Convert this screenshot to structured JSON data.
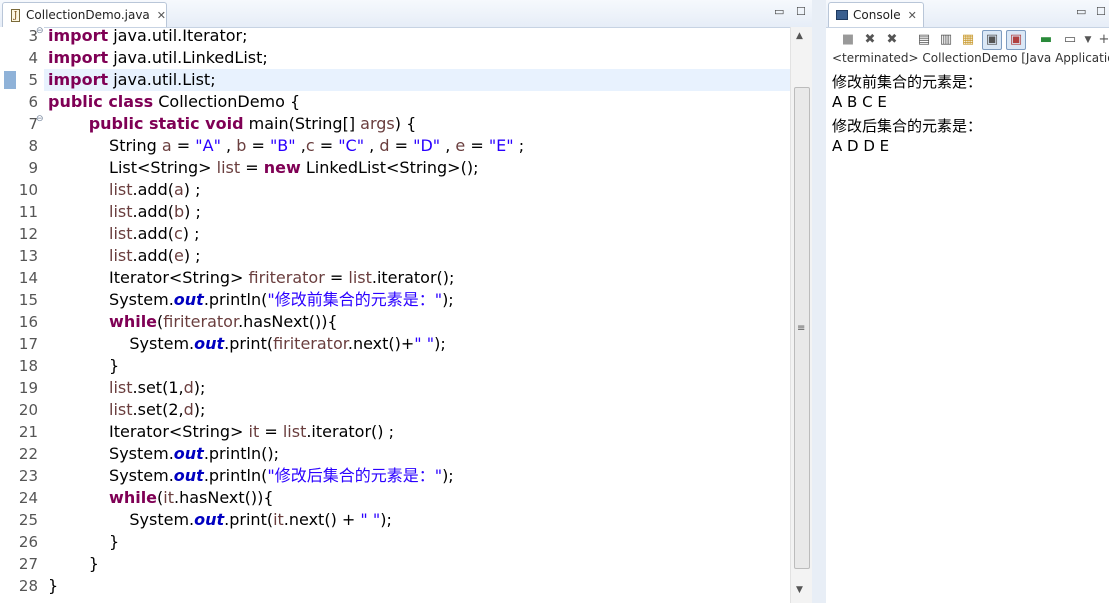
{
  "editor": {
    "tab_title": "CollectionDemo.java",
    "lines": [
      {
        "n": "3",
        "fold": "⊖",
        "tokens": [
          {
            "t": "import",
            "c": "kw"
          },
          {
            "t": " java.util.Iterator;"
          }
        ]
      },
      {
        "n": "4",
        "tokens": [
          {
            "t": "import",
            "c": "kw"
          },
          {
            "t": " java.util.LinkedList;"
          }
        ]
      },
      {
        "n": "5",
        "cur": true,
        "tokens": [
          {
            "t": "import",
            "c": "kw"
          },
          {
            "t": " java.util.List;"
          }
        ]
      },
      {
        "n": "6",
        "tokens": [
          {
            "t": "public class",
            "c": "kw"
          },
          {
            "t": " CollectionDemo {"
          }
        ]
      },
      {
        "n": "7",
        "fold": "⊖",
        "tokens": [
          {
            "t": "        "
          },
          {
            "t": "public static void",
            "c": "kw"
          },
          {
            "t": " main(String[] "
          },
          {
            "t": "args",
            "c": "var"
          },
          {
            "t": ") {"
          }
        ]
      },
      {
        "n": "8",
        "tokens": [
          {
            "t": "            String "
          },
          {
            "t": "a",
            "c": "var"
          },
          {
            "t": " = "
          },
          {
            "t": "\"A\"",
            "c": "str"
          },
          {
            "t": " , "
          },
          {
            "t": "b",
            "c": "var"
          },
          {
            "t": " = "
          },
          {
            "t": "\"B\"",
            "c": "str"
          },
          {
            "t": " ,"
          },
          {
            "t": "c",
            "c": "var"
          },
          {
            "t": " = "
          },
          {
            "t": "\"C\"",
            "c": "str"
          },
          {
            "t": " , "
          },
          {
            "t": "d",
            "c": "var"
          },
          {
            "t": " = "
          },
          {
            "t": "\"D\"",
            "c": "str"
          },
          {
            "t": " , "
          },
          {
            "t": "e",
            "c": "var"
          },
          {
            "t": " = "
          },
          {
            "t": "\"E\"",
            "c": "str"
          },
          {
            "t": " ;"
          }
        ]
      },
      {
        "n": "9",
        "tokens": [
          {
            "t": "            List<String> "
          },
          {
            "t": "list",
            "c": "var"
          },
          {
            "t": " = "
          },
          {
            "t": "new",
            "c": "kw"
          },
          {
            "t": " LinkedList<String>();"
          }
        ]
      },
      {
        "n": "10",
        "tokens": [
          {
            "t": "            "
          },
          {
            "t": "list",
            "c": "var"
          },
          {
            "t": ".add("
          },
          {
            "t": "a",
            "c": "var"
          },
          {
            "t": ") ;"
          }
        ]
      },
      {
        "n": "11",
        "tokens": [
          {
            "t": "            "
          },
          {
            "t": "list",
            "c": "var"
          },
          {
            "t": ".add("
          },
          {
            "t": "b",
            "c": "var"
          },
          {
            "t": ") ;"
          }
        ]
      },
      {
        "n": "12",
        "tokens": [
          {
            "t": "            "
          },
          {
            "t": "list",
            "c": "var"
          },
          {
            "t": ".add("
          },
          {
            "t": "c",
            "c": "var"
          },
          {
            "t": ") ;"
          }
        ]
      },
      {
        "n": "13",
        "tokens": [
          {
            "t": "            "
          },
          {
            "t": "list",
            "c": "var"
          },
          {
            "t": ".add("
          },
          {
            "t": "e",
            "c": "var"
          },
          {
            "t": ") ;"
          }
        ]
      },
      {
        "n": "14",
        "tokens": [
          {
            "t": "            Iterator<String> "
          },
          {
            "t": "firiterator",
            "c": "var"
          },
          {
            "t": " = "
          },
          {
            "t": "list",
            "c": "var"
          },
          {
            "t": ".iterator();"
          }
        ]
      },
      {
        "n": "15",
        "tokens": [
          {
            "t": "            System."
          },
          {
            "t": "out",
            "c": "fld"
          },
          {
            "t": ".println("
          },
          {
            "t": "\"修改前集合的元素是：\"",
            "c": "str"
          },
          {
            "t": ");"
          }
        ]
      },
      {
        "n": "16",
        "tokens": [
          {
            "t": "            "
          },
          {
            "t": "while",
            "c": "kw"
          },
          {
            "t": "("
          },
          {
            "t": "firiterator",
            "c": "var"
          },
          {
            "t": ".hasNext()){"
          }
        ]
      },
      {
        "n": "17",
        "tokens": [
          {
            "t": "                System."
          },
          {
            "t": "out",
            "c": "fld"
          },
          {
            "t": ".print("
          },
          {
            "t": "firiterator",
            "c": "var"
          },
          {
            "t": ".next()+"
          },
          {
            "t": "\" \"",
            "c": "str"
          },
          {
            "t": ");"
          }
        ]
      },
      {
        "n": "18",
        "tokens": [
          {
            "t": "            }"
          }
        ]
      },
      {
        "n": "19",
        "tokens": [
          {
            "t": "            "
          },
          {
            "t": "list",
            "c": "var"
          },
          {
            "t": ".set(1,"
          },
          {
            "t": "d",
            "c": "var"
          },
          {
            "t": ");"
          }
        ]
      },
      {
        "n": "20",
        "tokens": [
          {
            "t": "            "
          },
          {
            "t": "list",
            "c": "var"
          },
          {
            "t": ".set(2,"
          },
          {
            "t": "d",
            "c": "var"
          },
          {
            "t": ");"
          }
        ]
      },
      {
        "n": "21",
        "tokens": [
          {
            "t": "            Iterator<String> "
          },
          {
            "t": "it",
            "c": "var"
          },
          {
            "t": " = "
          },
          {
            "t": "list",
            "c": "var"
          },
          {
            "t": ".iterator() ;"
          }
        ]
      },
      {
        "n": "22",
        "tokens": [
          {
            "t": "            System."
          },
          {
            "t": "out",
            "c": "fld"
          },
          {
            "t": ".println();"
          }
        ]
      },
      {
        "n": "23",
        "tokens": [
          {
            "t": "            System."
          },
          {
            "t": "out",
            "c": "fld"
          },
          {
            "t": ".println("
          },
          {
            "t": "\"修改后集合的元素是：\"",
            "c": "str"
          },
          {
            "t": ");"
          }
        ]
      },
      {
        "n": "24",
        "tokens": [
          {
            "t": "            "
          },
          {
            "t": "while",
            "c": "kw"
          },
          {
            "t": "("
          },
          {
            "t": "it",
            "c": "var"
          },
          {
            "t": ".hasNext()){"
          }
        ]
      },
      {
        "n": "25",
        "tokens": [
          {
            "t": "                System."
          },
          {
            "t": "out",
            "c": "fld"
          },
          {
            "t": ".print("
          },
          {
            "t": "it",
            "c": "var"
          },
          {
            "t": ".next() + "
          },
          {
            "t": "\" \"",
            "c": "str"
          },
          {
            "t": ");"
          }
        ]
      },
      {
        "n": "26",
        "tokens": [
          {
            "t": "            }"
          }
        ]
      },
      {
        "n": "27",
        "tokens": [
          {
            "t": "        }"
          }
        ]
      },
      {
        "n": "28",
        "tokens": [
          {
            "t": "}"
          }
        ]
      }
    ]
  },
  "console": {
    "tab_title": "Console",
    "status": "<terminated> CollectionDemo [Java Application",
    "output": [
      "修改前集合的元素是：",
      "A B C E",
      "修改后集合的元素是：",
      "A D D E"
    ]
  },
  "icons": {
    "tab_close": "✕",
    "minimize": "▭",
    "maximize": "☐"
  },
  "colors": {
    "keyword": "#7f0055",
    "string": "#2a00ff",
    "local_variable": "#6a3e3e",
    "static_field": "#0000c0",
    "current_line": "#e8f2fe"
  }
}
